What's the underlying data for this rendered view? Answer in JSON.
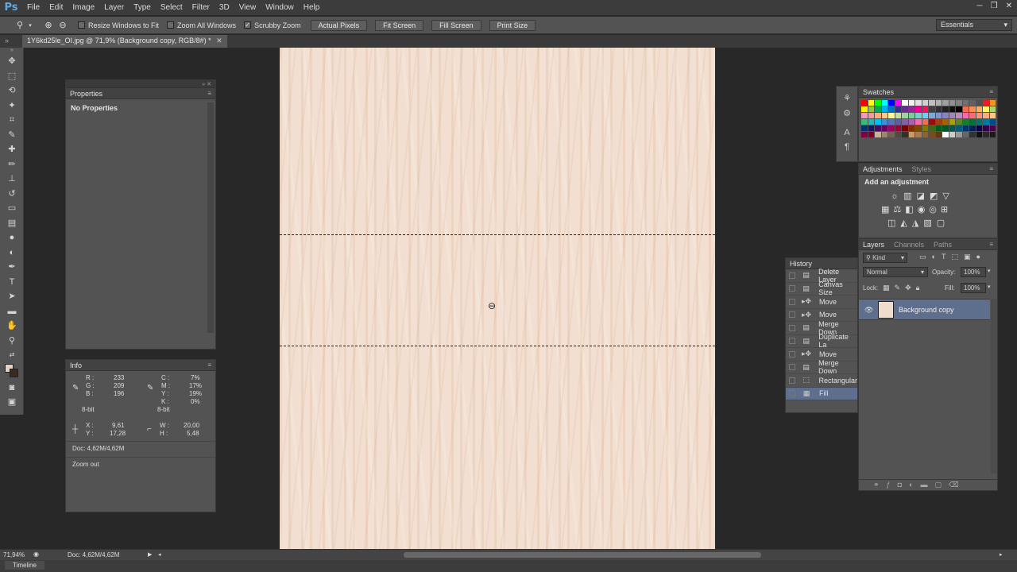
{
  "app": {
    "logo": "Ps"
  },
  "menubar": {
    "items": [
      "File",
      "Edit",
      "Image",
      "Layer",
      "Type",
      "Select",
      "Filter",
      "3D",
      "View",
      "Window",
      "Help"
    ],
    "win_controls": [
      "─",
      "❐",
      "✕"
    ]
  },
  "options": {
    "resize_windows": "Resize Windows to Fit",
    "zoom_all": "Zoom All Windows",
    "scrubby": "Scrubby Zoom",
    "actual_pixels": "Actual Pixels",
    "fit_screen": "Fit Screen",
    "fill_screen": "Fill Screen",
    "print_size": "Print Size",
    "workspace": "Essentials"
  },
  "document": {
    "tab": "1Y6kd25le_OI.jpg @ 71,9% (Background copy, RGB/8#) *"
  },
  "properties": {
    "title": "Properties",
    "message": "No Properties"
  },
  "info": {
    "title": "Info",
    "r_label": "R :",
    "r": "233",
    "g_label": "G :",
    "g": "209",
    "b_label": "B :",
    "b": "196",
    "c_label": "C :",
    "c": "7%",
    "m_label": "M :",
    "m": "17%",
    "y_label": "Y :",
    "y": "19%",
    "k_label": "K :",
    "k": "0%",
    "bit1": "8-bit",
    "bit2": "8-bit",
    "x_label": "X :",
    "x": "9,61",
    "ypos_label": "Y :",
    "ypos": "17,28",
    "w_label": "W :",
    "w": "20,00",
    "h_label": "H :",
    "h": "5,48",
    "doc": "Doc: 4,62M/4,62M",
    "status": "Zoom out"
  },
  "statusbar": {
    "zoom": "71,94%",
    "doc": "Doc: 4,62M/4,62M"
  },
  "timeline": {
    "label": "Timeline"
  },
  "swatches": {
    "tab": "Swatches",
    "colors": [
      "#ff0000",
      "#ffff00",
      "#00ff00",
      "#00ffff",
      "#0000ff",
      "#ff00ff",
      "#ffffff",
      "#f0f0f0",
      "#e0e0e0",
      "#d0d0d0",
      "#c0c0c0",
      "#b0b0b0",
      "#a0a0a0",
      "#909090",
      "#808080",
      "#707070",
      "#606060",
      "#505050",
      "#ed1c24",
      "#f7941d",
      "#fff200",
      "#8dc63f",
      "#00a651",
      "#00aeef",
      "#0072bc",
      "#2e3192",
      "#662d91",
      "#92278f",
      "#ec008c",
      "#ed145b",
      "#404040",
      "#303030",
      "#202020",
      "#101010",
      "#000000",
      "#f26c4f",
      "#f68e56",
      "#fbaf5d",
      "#fff568",
      "#acd373",
      "#f49ac1",
      "#f5989d",
      "#f9ad81",
      "#fdc68a",
      "#fff79a",
      "#c4df9b",
      "#a3d39c",
      "#82ca9d",
      "#7bcdc8",
      "#6ecff6",
      "#7ea7d8",
      "#8493ca",
      "#8882be",
      "#a186be",
      "#bd8cbf",
      "#f06eaa",
      "#f26d7d",
      "#f7977a",
      "#fbad82",
      "#fdc689",
      "#3cb878",
      "#1cbbb4",
      "#00bff3",
      "#448ccb",
      "#5674b9",
      "#605ca8",
      "#855fa8",
      "#a863a8",
      "#f06ea9",
      "#f26c4f",
      "#9e0b0f",
      "#a0410d",
      "#a36209",
      "#aba000",
      "#598527",
      "#1a7b30",
      "#007236",
      "#00746b",
      "#0076a3",
      "#004b80",
      "#003471",
      "#1b1464",
      "#440e62",
      "#630460",
      "#9e005d",
      "#9e0039",
      "#790000",
      "#7b2e00",
      "#7d4900",
      "#827b00",
      "#406618",
      "#005e20",
      "#005826",
      "#005952",
      "#005b7f",
      "#003663",
      "#002157",
      "#0d004c",
      "#32004b",
      "#4b0049",
      "#7b0046",
      "#7a0026",
      "#c7b299",
      "#998675",
      "#736357",
      "#534741",
      "#37302a",
      "#c69c6d",
      "#a67c52",
      "#8c6239",
      "#754c24",
      "#603913",
      "#ffffff",
      "#cccccc",
      "#999999",
      "#666666",
      "#333333",
      "#111111",
      "#2a2a2a",
      "#1a1a1a"
    ]
  },
  "adjustments": {
    "tab": "Adjustments",
    "tab2": "Styles",
    "header": "Add an adjustment"
  },
  "layers": {
    "tab": "Layers",
    "tab2": "Channels",
    "tab3": "Paths",
    "kind": "Kind",
    "blend": "Normal",
    "opacity_label": "Opacity:",
    "opacity": "100%",
    "lock_label": "Lock:",
    "fill_label": "Fill:",
    "fill": "100%",
    "layer_name": "Background copy"
  },
  "history": {
    "title": "History",
    "items": [
      "Delete Layer",
      "Canvas Size",
      "Move",
      "Move",
      "Merge Down",
      "Duplicate La",
      "Move",
      "Merge Down",
      "Rectangular",
      "Fill"
    ]
  }
}
